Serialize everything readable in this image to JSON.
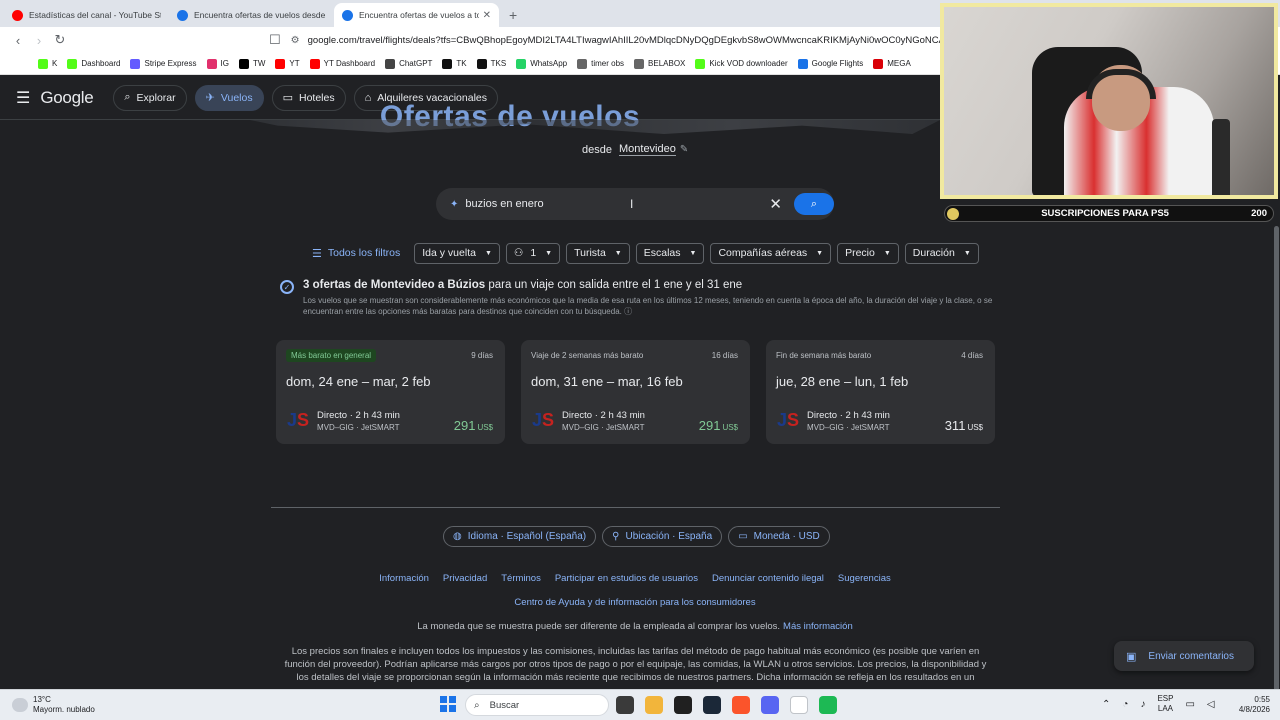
{
  "browser": {
    "tabs": [
      {
        "title": "Estadísticas del canal - YouTube Studio",
        "color": "#ff0000",
        "active": false
      },
      {
        "title": "Encuentra ofertas de vuelos desde Montevideo",
        "color": "#1a73e8",
        "active": false
      },
      {
        "title": "Encuentra ofertas de vuelos a todas partes",
        "color": "#1a73e8",
        "active": true
      }
    ],
    "url": "google.com/travel/flights/deals?tfs=CBwQBhopEgoyMDI2LTA4LTIwagwIAhIIL20vMDlqcDNyDQgDEgkvbS8wOWMwcncaKRIKMjAyNi0wOC0yNGoNCAMS...",
    "bookmarks": [
      {
        "label": "K",
        "color": "#53fc18"
      },
      {
        "label": "Dashboard",
        "color": "#53fc18"
      },
      {
        "label": "Stripe Express",
        "color": "#635bff"
      },
      {
        "label": "IG",
        "color": "#e1306c"
      },
      {
        "label": "TW",
        "color": "#000000"
      },
      {
        "label": "YT",
        "color": "#ff0000"
      },
      {
        "label": "YT Dashboard",
        "color": "#ff0000"
      },
      {
        "label": "ChatGPT",
        "color": "#444444"
      },
      {
        "label": "TK",
        "color": "#111111"
      },
      {
        "label": "TKS",
        "color": "#111111"
      },
      {
        "label": "WhatsApp",
        "color": "#25d366"
      },
      {
        "label": "timer obs",
        "color": "#666666"
      },
      {
        "label": "BELABOX",
        "color": "#666666"
      },
      {
        "label": "Kick VOD downloader",
        "color": "#53fc18"
      },
      {
        "label": "Google Flights",
        "color": "#1a73e8"
      },
      {
        "label": "MEGA",
        "color": "#d90007"
      }
    ]
  },
  "header": {
    "logo": "Google",
    "nav": [
      {
        "label": "Explorar",
        "icon": "⌕",
        "active": false
      },
      {
        "label": "Vuelos",
        "icon": "✈",
        "active": true
      },
      {
        "label": "Hoteles",
        "icon": "▭",
        "active": false
      },
      {
        "label": "Alquileres vacacionales",
        "icon": "⌂",
        "active": false
      }
    ]
  },
  "hero": {
    "title": "Ofertas de vuelos",
    "from_label": "desde",
    "origin": "Montevideo"
  },
  "search": {
    "value": "buzios en enero"
  },
  "filters": {
    "all_label": "Todos los filtros",
    "chips": [
      "Ida y vuelta",
      "1",
      "Turista",
      "Escalas",
      "Compañías aéreas",
      "Precio",
      "Duración"
    ]
  },
  "summary": {
    "bold": "3 ofertas de Montevideo a Búzios",
    "rest": " para un viaje con salida entre el 1 ene y el 31 ene",
    "note": "Los vuelos que se muestran son considerablemente más económicos que la media de esa ruta en los últimos 12 meses, teniendo en cuenta la época del año, la duración del viaje y la clase, o se encuentran entre las opciones más baratas para destinos que coinciden con tu búsqueda."
  },
  "deals": [
    {
      "label": "Más barato en general",
      "days": "9 días",
      "dates": "dom, 24 ene – mar, 2 feb",
      "stops": "Directo · 2 h 43 min",
      "route": "MVD–GIG · JetSMART",
      "price": "291",
      "currency": "US$",
      "badge": true,
      "price_color": "#81c995"
    },
    {
      "label": "Viaje de 2 semanas más barato",
      "days": "16 días",
      "dates": "dom, 31 ene – mar, 16 feb",
      "stops": "Directo · 2 h 43 min",
      "route": "MVD–GIG · JetSMART",
      "price": "291",
      "currency": "US$",
      "badge": false,
      "price_color": "#81c995"
    },
    {
      "label": "Fin de semana más barato",
      "days": "4 días",
      "dates": "jue, 28 ene – lun, 1 feb",
      "stops": "Directo · 2 h 43 min",
      "route": "MVD–GIG · JetSMART",
      "price": "311",
      "currency": "US$",
      "badge": false,
      "price_color": "#e8eaed"
    }
  ],
  "settings": {
    "language": "Idioma · Español (España)",
    "location": "Ubicación · España",
    "currency": "Moneda · USD"
  },
  "footer": {
    "links": [
      "Información",
      "Privacidad",
      "Términos",
      "Participar en estudios de usuarios",
      "Denunciar contenido ilegal",
      "Sugerencias"
    ],
    "help": "Centro de Ayuda y de información para los consumidores",
    "currency_note": "La moneda que se muestra puede ser diferente de la empleada al comprar los vuelos.",
    "more_info": "Más información",
    "disclaimer": "Los precios son finales e incluyen todos los impuestos y las comisiones, incluidas las tarifas del método de pago habitual más económico (es posible que varíen en función del proveedor). Podrían aplicarse más cargos por otros tipos de pago o por el equipaje, las comidas, la WLAN u otros servicios. Los precios, la disponibilidad y los detalles del viaje se proporcionan según la información más reciente que recibimos de nuestros partners. Dicha información se refleja en los resultados en un"
  },
  "feedback_label": "Enviar comentarios",
  "overlay": {
    "ps5_label": "SUSCRIPCIONES PARA PS5",
    "ps5_count": "200"
  },
  "taskbar": {
    "temp": "13°C",
    "weather": "Mayorm. nublado",
    "search_placeholder": "Buscar",
    "lang_top": "ESP",
    "lang_bottom": "LAA",
    "time": "0:55",
    "date": "4/8/2026",
    "apps": [
      "#3a3a3a",
      "#f2b53b",
      "#202020",
      "#1b2838",
      "#fb542b",
      "#5865f2",
      "#ffffff",
      "#1db954"
    ]
  }
}
